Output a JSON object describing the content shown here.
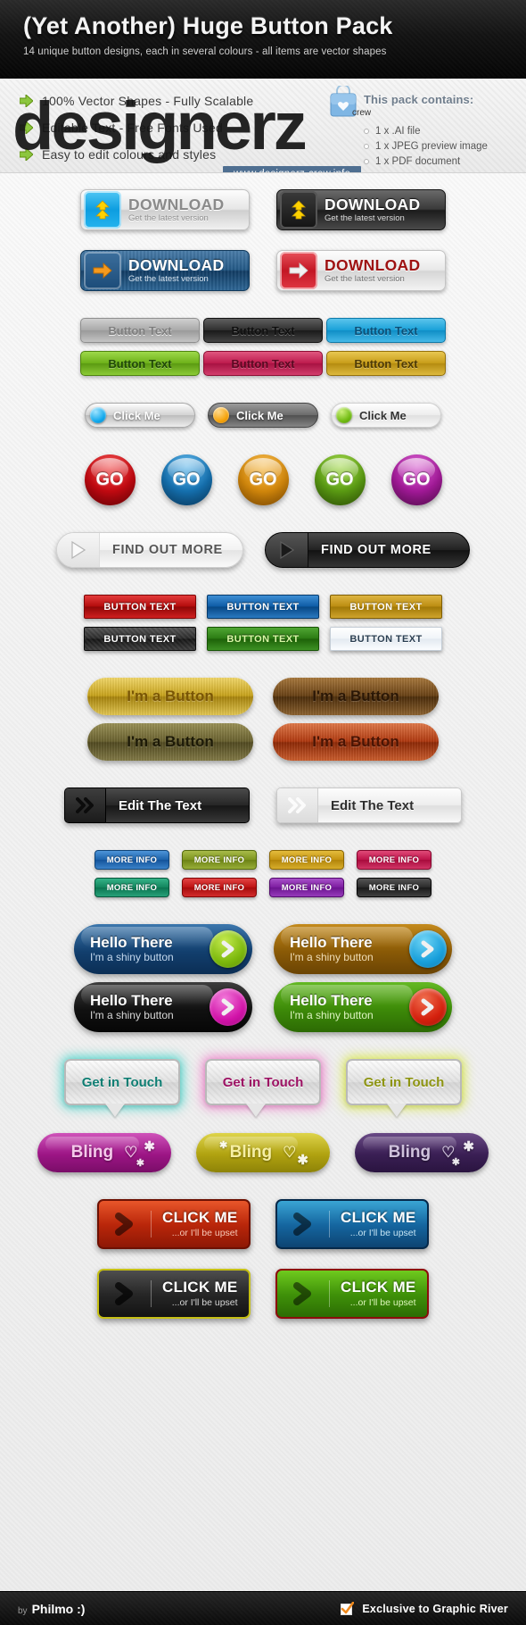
{
  "header": {
    "title": "(Yet Another) Huge Button Pack",
    "subtitle": "14 unique button designs, each in several colours - all items are vector shapes"
  },
  "features": [
    "100% Vector Shapes - Fully Scalable",
    "Editable Text - Free Fonts Used",
    "Easy to edit colours and styles"
  ],
  "pack": {
    "title": "This pack contains:",
    "items": [
      "1 x .AI file",
      "1 x JPEG preview image",
      "1 x PDF document"
    ]
  },
  "watermark": {
    "text": "designerz",
    "crew": "crew",
    "url": "www.designerz-crew.info"
  },
  "download_buttons": [
    {
      "title": "DOWNLOAD",
      "subtitle": "Get the latest version",
      "style": "grey",
      "icon": "download-arrow-icon"
    },
    {
      "title": "DOWNLOAD",
      "subtitle": "Get the latest version",
      "style": "dark",
      "icon": "download-arrow-icon"
    },
    {
      "title": "DOWNLOAD",
      "subtitle": "Get the latest version",
      "style": "blue",
      "icon": "right-arrow-icon"
    },
    {
      "title": "DOWNLOAD",
      "subtitle": "Get the latest version",
      "style": "red",
      "icon": "right-arrow-icon"
    }
  ],
  "button_text": {
    "label": "Button Text",
    "colors": [
      "grey",
      "black",
      "blue",
      "green",
      "pink",
      "gold"
    ]
  },
  "click_me_pills": {
    "label": "Click Me",
    "variants": [
      "silver",
      "dark",
      "white"
    ]
  },
  "go_buttons": {
    "label": "GO",
    "colors": [
      "red",
      "blue",
      "orange",
      "green",
      "purple"
    ]
  },
  "find_out_more": {
    "label": "FIND OUT MORE",
    "variants": [
      "light",
      "dark"
    ],
    "icon": "play-triangle-icon"
  },
  "button_text_ribbons": {
    "label": "BUTTON TEXT",
    "colors": [
      "red",
      "blue",
      "gold",
      "carbon",
      "green",
      "white"
    ]
  },
  "im_a_button": {
    "label": "I'm a Button",
    "colors": [
      "gold",
      "brown",
      "olive",
      "rust"
    ]
  },
  "edit_the_text": {
    "label": "Edit The Text",
    "variants": [
      "dark",
      "light"
    ],
    "icon": "double-chevron-icon"
  },
  "more_info": {
    "label": "MORE INFO",
    "colors": [
      "blue",
      "olive",
      "gold",
      "pink",
      "teal",
      "red",
      "purple",
      "black"
    ]
  },
  "hello_there": {
    "title": "Hello There",
    "subtitle": "I'm a shiny button",
    "icon": "chevron-right-icon",
    "variants": [
      "blue",
      "brown",
      "black",
      "green"
    ]
  },
  "get_in_touch": {
    "label": "Get in Touch",
    "glows": [
      "teal",
      "pink",
      "yellow"
    ]
  },
  "bling": {
    "label": "Bling",
    "icon": "heart-icon",
    "colors": [
      "magenta",
      "gold",
      "purple"
    ]
  },
  "click_me_big": {
    "title": "CLICK ME",
    "subtitle": "...or I'll be upset",
    "icon": "chevron-right-icon",
    "colors": [
      "red",
      "blue",
      "black",
      "green"
    ]
  },
  "footer": {
    "by_label": "by",
    "author": "Philmo :)",
    "exclusive": "Exclusive to Graphic River",
    "check_icon": "orange-checkmark-icon"
  },
  "colors": {
    "header_bg": "#131313",
    "accent_blue": "#4f6f91",
    "pack_title": "#6f7d8c"
  }
}
